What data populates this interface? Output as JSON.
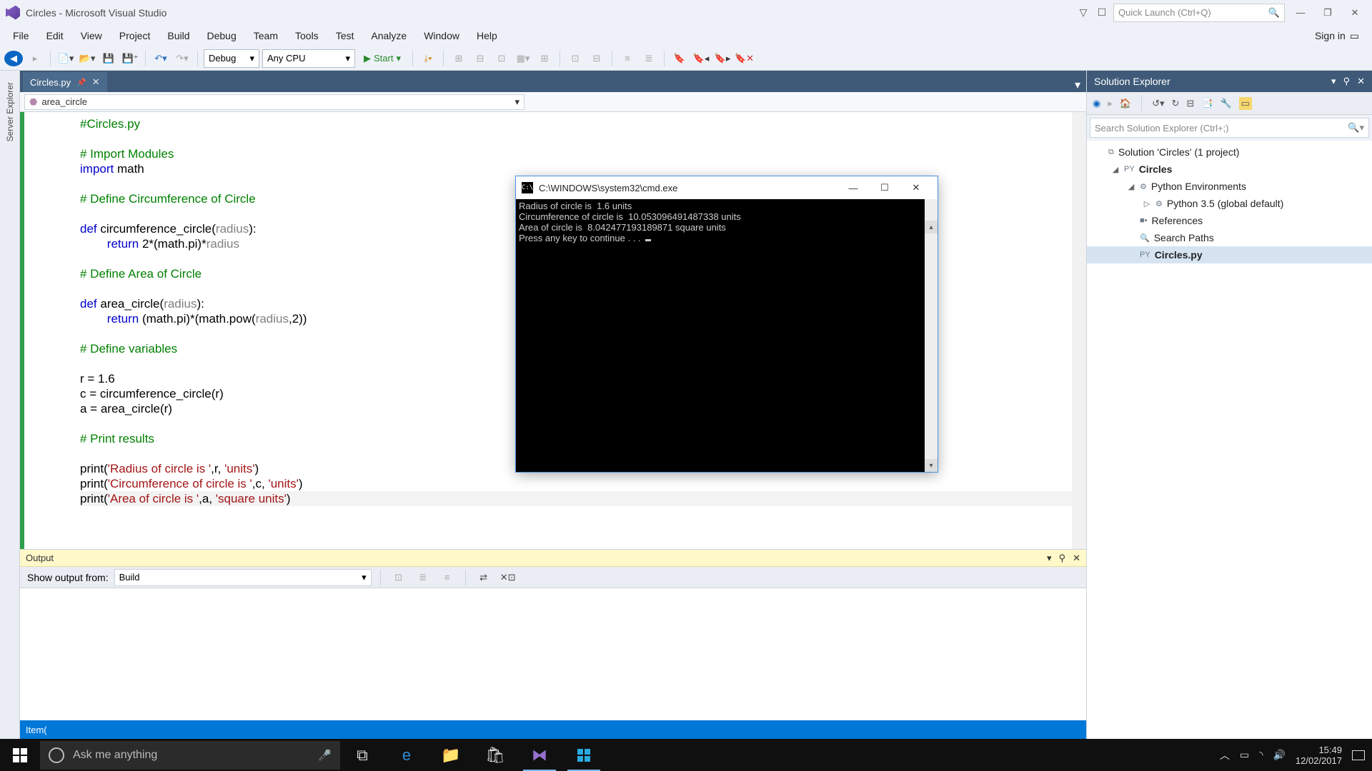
{
  "title": "Circles - Microsoft Visual Studio",
  "quick_launch_placeholder": "Quick Launch (Ctrl+Q)",
  "menus": [
    "File",
    "Edit",
    "View",
    "Project",
    "Build",
    "Debug",
    "Team",
    "Tools",
    "Test",
    "Analyze",
    "Window",
    "Help"
  ],
  "signin": "Sign in",
  "toolbar": {
    "config": "Debug",
    "platform": "Any CPU",
    "start": "Start"
  },
  "side_tab": "Server Explorer",
  "doc_tab": "Circles.py",
  "nav_member": "area_circle",
  "code_lines": [
    {
      "segs": [
        {
          "t": "#Circles.py",
          "c": "c-com"
        }
      ]
    },
    {
      "segs": []
    },
    {
      "segs": [
        {
          "t": "# Import Modules",
          "c": "c-com"
        }
      ]
    },
    {
      "segs": [
        {
          "t": "import",
          "c": "c-kw"
        },
        {
          "t": " math",
          "c": ""
        }
      ]
    },
    {
      "segs": []
    },
    {
      "segs": [
        {
          "t": "# Define Circumference of Circle",
          "c": "c-com"
        }
      ]
    },
    {
      "segs": []
    },
    {
      "segs": [
        {
          "t": "def",
          "c": "c-kw"
        },
        {
          "t": " circumference_circle(",
          "c": ""
        },
        {
          "t": "radius",
          "c": "c-par"
        },
        {
          "t": "):",
          "c": ""
        }
      ]
    },
    {
      "segs": [
        {
          "t": "        ",
          "c": ""
        },
        {
          "t": "return",
          "c": "c-kw"
        },
        {
          "t": " 2*(math.pi)*",
          "c": ""
        },
        {
          "t": "radius",
          "c": "c-par"
        }
      ]
    },
    {
      "segs": []
    },
    {
      "segs": [
        {
          "t": "# Define Area of Circle",
          "c": "c-com"
        }
      ]
    },
    {
      "segs": []
    },
    {
      "segs": [
        {
          "t": "def",
          "c": "c-kw"
        },
        {
          "t": " area_circle(",
          "c": ""
        },
        {
          "t": "radius",
          "c": "c-par"
        },
        {
          "t": "):",
          "c": ""
        }
      ]
    },
    {
      "segs": [
        {
          "t": "        ",
          "c": ""
        },
        {
          "t": "return",
          "c": "c-kw"
        },
        {
          "t": " (math.pi)*(math.pow(",
          "c": ""
        },
        {
          "t": "radius",
          "c": "c-par"
        },
        {
          "t": ",2))",
          "c": ""
        }
      ]
    },
    {
      "segs": []
    },
    {
      "segs": [
        {
          "t": "# Define variables",
          "c": "c-com"
        }
      ]
    },
    {
      "segs": []
    },
    {
      "segs": [
        {
          "t": "r = 1.6",
          "c": ""
        }
      ]
    },
    {
      "segs": [
        {
          "t": "c = circumference_circle(r)",
          "c": ""
        }
      ]
    },
    {
      "segs": [
        {
          "t": "a = area_circle(r)",
          "c": ""
        }
      ]
    },
    {
      "segs": []
    },
    {
      "segs": [
        {
          "t": "# Print results",
          "c": "c-com"
        }
      ]
    },
    {
      "segs": []
    },
    {
      "segs": [
        {
          "t": "print(",
          "c": ""
        },
        {
          "t": "'Radius of circle is '",
          "c": "c-str"
        },
        {
          "t": ",r, ",
          "c": ""
        },
        {
          "t": "'units'",
          "c": "c-str"
        },
        {
          "t": ")",
          "c": ""
        }
      ]
    },
    {
      "segs": [
        {
          "t": "print(",
          "c": ""
        },
        {
          "t": "'Circumference of circle is '",
          "c": "c-str"
        },
        {
          "t": ",c, ",
          "c": ""
        },
        {
          "t": "'units'",
          "c": "c-str"
        },
        {
          "t": ")",
          "c": ""
        }
      ]
    },
    {
      "hl": true,
      "segs": [
        {
          "t": "print(",
          "c": ""
        },
        {
          "t": "'Area of circle is '",
          "c": "c-str"
        },
        {
          "t": ",a, ",
          "c": ""
        },
        {
          "t": "'square units'",
          "c": "c-str"
        },
        {
          "t": ")",
          "c": ""
        }
      ]
    }
  ],
  "solution_explorer": {
    "title": "Solution Explorer",
    "search_placeholder": "Search Solution Explorer (Ctrl+;)",
    "nodes": [
      {
        "depth": 0,
        "exp": "",
        "icon": "⧉",
        "label": "Solution 'Circles' (1 project)"
      },
      {
        "depth": 1,
        "exp": "◢",
        "icon": "PY",
        "label": "Circles",
        "bold": true
      },
      {
        "depth": 2,
        "exp": "◢",
        "icon": "⚙",
        "label": "Python Environments"
      },
      {
        "depth": 3,
        "exp": "▷",
        "icon": "⚙",
        "label": "Python 3.5 (global default)"
      },
      {
        "depth": 2,
        "exp": "",
        "icon": "■▪",
        "label": "References"
      },
      {
        "depth": 2,
        "exp": "",
        "icon": "🔍",
        "label": "Search Paths"
      },
      {
        "depth": 2,
        "exp": "",
        "icon": "PY",
        "label": "Circles.py",
        "sel": true,
        "bold": true
      }
    ]
  },
  "output": {
    "title": "Output",
    "show_from_label": "Show output from:",
    "show_from_value": "Build"
  },
  "status": "Item(",
  "console": {
    "title": "C:\\WINDOWS\\system32\\cmd.exe",
    "lines": [
      "Radius of circle is  1.6 units",
      "Circumference of circle is  10.053096491487338 units",
      "Area of circle is  8.042477193189871 square units",
      "Press any key to continue . . . "
    ]
  },
  "taskbar": {
    "cortana_placeholder": "Ask me anything",
    "time": "15:49",
    "date": "12/02/2017"
  }
}
